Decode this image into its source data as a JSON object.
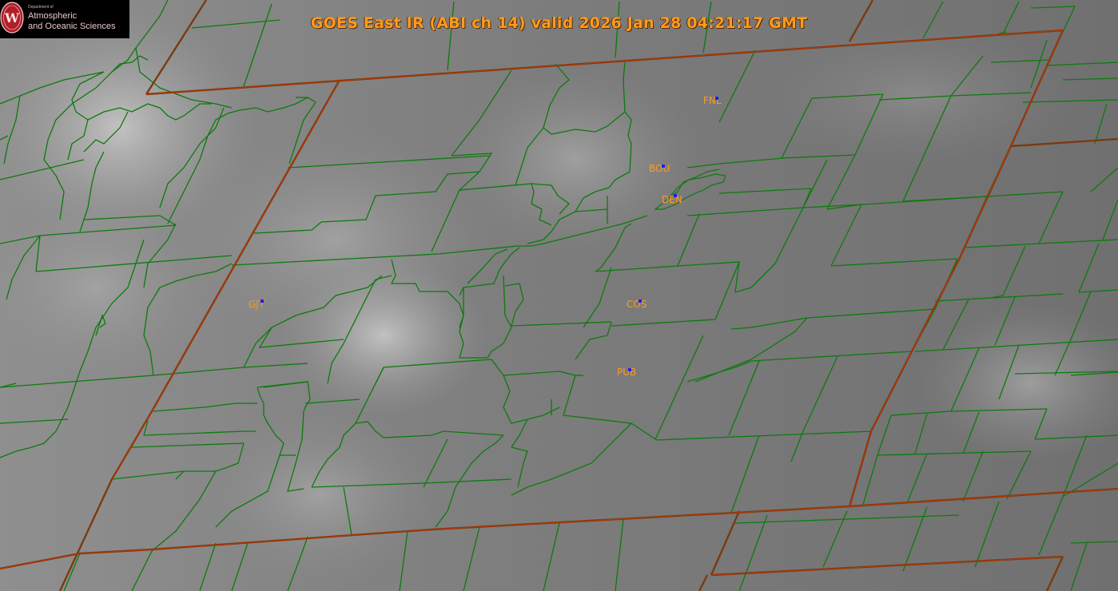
{
  "title": "GOES East IR (ABI ch 14) valid 2026 Jan 28 04:21:17 GMT",
  "logo": {
    "dept": "Department of",
    "line1": "Atmospheric",
    "line2": "and Oceanic Sciences",
    "seal_letter": "W"
  },
  "stations": [
    {
      "code": "FNL"
    },
    {
      "code": "BOU"
    },
    {
      "code": "DEN"
    },
    {
      "code": "GJT"
    },
    {
      "code": "COS"
    },
    {
      "code": "PUB"
    }
  ],
  "colors": {
    "state_border": "#7a3a10",
    "state_border_accent": "#cc3300",
    "county_border": "#0d7a0d",
    "station_label": "#ff9a1f",
    "station_marker": "#1a1aff",
    "title": "#ff9a1f"
  }
}
